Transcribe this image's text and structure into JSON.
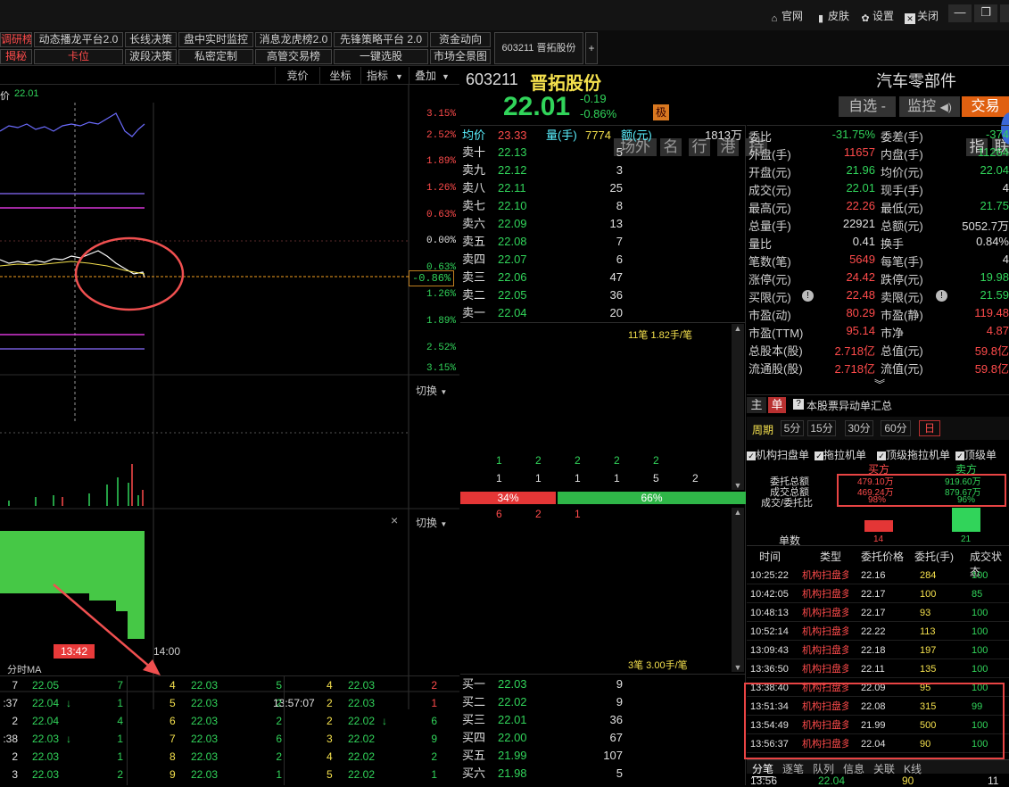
{
  "topbar": {
    "official": "官网",
    "skin": "皮肤",
    "settings": "设置",
    "close": "关闭"
  },
  "tabs_row1": [
    "调研榜",
    "动态播龙平台2.0",
    "长线决策",
    "盘中实时监控",
    "消息龙虎榜2.0",
    "先锋策略平台 2.0",
    "资金动向"
  ],
  "tabs_row2": [
    "揭秘",
    "卡位",
    "波段决策",
    "私密定制",
    "高管交易榜",
    "一键选股",
    "市场全景图"
  ],
  "active_tab": "603211 晋拓股份",
  "add_tab": "+",
  "chart_toolbar": {
    "price": "竞价",
    "coord": "坐标",
    "indicator": "指标",
    "overlay": "叠加"
  },
  "chart_price_label": "价",
  "chart_price": "22.01",
  "pct_labels_up": [
    "3.15%",
    "2.52%",
    "1.89%",
    "1.26%",
    "0.63%"
  ],
  "pct_zero": "0.00%",
  "pct_labels_down": [
    "0.63%",
    "1.26%",
    "1.89%",
    "2.52%",
    "3.15%"
  ],
  "pct_current": "-0.86%",
  "switch_label": "切换",
  "close_x": "×",
  "time_cursor": "13:42",
  "time_end": "14:00",
  "ma_label": "分时MA",
  "stock": {
    "code": "603211",
    "name": "晋拓股份",
    "tags": [
      "场外",
      "名",
      "行",
      "港",
      "持"
    ],
    "industry": "汽车零部件",
    "industry_btns": [
      "指",
      "联"
    ],
    "price": "22.01",
    "change": "-0.19",
    "change_pct": "-0.86%",
    "badge": "极"
  },
  "actions": {
    "fav": "自选",
    "monitor": "监控",
    "trade": "交易"
  },
  "summary": {
    "avg_label": "均价",
    "avg": "23.33",
    "vol_label": "量(手)",
    "vol": "7774",
    "amt_label": "额(元)",
    "amt": "1813万"
  },
  "sell": [
    {
      "label": "卖十",
      "price": "22.13",
      "qty": "5"
    },
    {
      "label": "卖九",
      "price": "22.12",
      "qty": "3"
    },
    {
      "label": "卖八",
      "price": "22.11",
      "qty": "25"
    },
    {
      "label": "卖七",
      "price": "22.10",
      "qty": "8"
    },
    {
      "label": "卖六",
      "price": "22.09",
      "qty": "13"
    },
    {
      "label": "卖五",
      "price": "22.08",
      "qty": "7"
    },
    {
      "label": "卖四",
      "price": "22.07",
      "qty": "6"
    },
    {
      "label": "卖三",
      "price": "22.06",
      "qty": "47"
    },
    {
      "label": "卖二",
      "price": "22.05",
      "qty": "36"
    },
    {
      "label": "卖一",
      "price": "22.04",
      "qty": "20"
    }
  ],
  "buy": [
    {
      "label": "买一",
      "price": "22.03",
      "qty": "9"
    },
    {
      "label": "买二",
      "price": "22.02",
      "qty": "9"
    },
    {
      "label": "买三",
      "price": "22.01",
      "qty": "36"
    },
    {
      "label": "买四",
      "price": "22.00",
      "qty": "67"
    },
    {
      "label": "买五",
      "price": "21.99",
      "qty": "107"
    },
    {
      "label": "买六",
      "price": "21.98",
      "qty": "5"
    }
  ],
  "queue_top": "11笔 1.82手/笔",
  "queue_bottom": "3笔 3.00手/笔",
  "queue_nums1": [
    "1",
    "2",
    "2",
    "2",
    "2"
  ],
  "queue_nums2": [
    "1",
    "1",
    "1",
    "1",
    "5",
    "2"
  ],
  "queue_nums3": [
    "6",
    "2",
    "1"
  ],
  "ratio_buy": "34%",
  "ratio_sell": "66%",
  "ratio_buy_value": 34,
  "stats_left": [
    {
      "k": "委比",
      "v": "-31.75%",
      "c": "g"
    },
    {
      "k": "外盘(手)",
      "v": "11657",
      "c": "r"
    },
    {
      "k": "开盘(元)",
      "v": "21.96",
      "c": "g"
    },
    {
      "k": "成交(元)",
      "v": "22.01",
      "c": "g"
    },
    {
      "k": "最高(元)",
      "v": "22.26",
      "c": "r"
    },
    {
      "k": "总量(手)",
      "v": "22921",
      "c": "w"
    },
    {
      "k": "量比",
      "v": "0.41",
      "c": "w"
    },
    {
      "k": "笔数(笔)",
      "v": "5649",
      "c": "r"
    },
    {
      "k": "涨停(元)",
      "v": "24.42",
      "c": "r"
    },
    {
      "k": "买限(元)",
      "v": "22.48",
      "c": "r"
    },
    {
      "k": "市盈(动)",
      "v": "80.29",
      "c": "r"
    },
    {
      "k": "市盈(TTM)",
      "v": "95.14",
      "c": "r"
    },
    {
      "k": "总股本(股)",
      "v": "2.718亿",
      "c": "r"
    },
    {
      "k": "流通股(股)",
      "v": "2.718亿",
      "c": "r"
    }
  ],
  "stats_right": [
    {
      "k": "委差(手)",
      "v": "-374",
      "c": "g"
    },
    {
      "k": "内盘(手)",
      "v": "11264",
      "c": "g"
    },
    {
      "k": "均价(元)",
      "v": "22.04",
      "c": "g"
    },
    {
      "k": "现手(手)",
      "v": "4",
      "c": "w"
    },
    {
      "k": "最低(元)",
      "v": "21.75",
      "c": "g"
    },
    {
      "k": "总额(元)",
      "v": "5052.7万",
      "c": "w"
    },
    {
      "k": "换手",
      "v": "0.84%",
      "c": "w"
    },
    {
      "k": "每笔(手)",
      "v": "4",
      "c": "w"
    },
    {
      "k": "跌停(元)",
      "v": "19.98",
      "c": "g"
    },
    {
      "k": "卖限(元)",
      "v": "21.59",
      "c": "g"
    },
    {
      "k": "市盈(静)",
      "v": "119.48",
      "c": "r"
    },
    {
      "k": "市净",
      "v": "4.87",
      "c": "r"
    },
    {
      "k": "总值(元)",
      "v": "59.8亿",
      "c": "r"
    },
    {
      "k": "流值(元)",
      "v": "59.8亿",
      "c": "r"
    }
  ],
  "unusual": {
    "main": "主",
    "single": "单",
    "title": "本股票异动单汇总",
    "period_label": "周期",
    "periods": [
      "5分",
      "15分",
      "30分",
      "60分",
      "日"
    ],
    "checks": [
      "机构扫盘单",
      "拖拉机单",
      "顶级拖拉机单",
      "顶级单"
    ]
  },
  "orders_summary": {
    "buy_label": "买方",
    "sell_label": "卖方",
    "row_labels": [
      "委托总额",
      "成交总额",
      "成交/委托比"
    ],
    "buy_vals": [
      "479.10万",
      "469.24万",
      "98%"
    ],
    "sell_vals": [
      "919.60万",
      "879.67万",
      "96%"
    ],
    "count_label": "单数",
    "buy_count": "14",
    "sell_count": "21"
  },
  "order_table": {
    "headers": [
      "时间",
      "类型",
      "委托价格",
      "委托(手)",
      "成交状态"
    ],
    "rows": [
      [
        "10:25:22",
        "机构扫盘多",
        "22.16",
        "284",
        "100"
      ],
      [
        "10:42:05",
        "机构扫盘多",
        "22.17",
        "100",
        "85"
      ],
      [
        "10:48:13",
        "机构扫盘多",
        "22.17",
        "93",
        "100"
      ],
      [
        "10:52:14",
        "机构扫盘多",
        "22.22",
        "113",
        "100"
      ],
      [
        "13:09:43",
        "机构扫盘多",
        "22.18",
        "197",
        "100"
      ],
      [
        "13:36:50",
        "机构扫盘多",
        "22.11",
        "135",
        "100"
      ],
      [
        "13:38:40",
        "机构扫盘多",
        "22.09",
        "95",
        "100"
      ],
      [
        "13:51:34",
        "机构扫盘多",
        "22.08",
        "315",
        "99"
      ],
      [
        "13:54:49",
        "机构扫盘多",
        "21.99",
        "500",
        "100"
      ],
      [
        "13:56:37",
        "机构扫盘多",
        "22.04",
        "90",
        "100"
      ]
    ]
  },
  "bottom_tabs": [
    "分笔",
    "逐笔",
    "队列",
    "信息",
    "关联",
    "K线"
  ],
  "bottom_tick": {
    "time": "13:56",
    "price": "22.04",
    "vol": "90",
    "n": "11"
  },
  "ticks": {
    "col1": [
      {
        "a": "7",
        "p": "22.05",
        "n": "7"
      },
      {
        "a": ":37",
        "p": "22.04",
        "arr": "↓",
        "n": "1"
      },
      {
        "a": "2",
        "p": "22.04",
        "n": "4"
      },
      {
        "a": ":38",
        "p": "22.03",
        "arr": "↓",
        "n": "1"
      },
      {
        "a": "2",
        "p": "22.03",
        "n": "1"
      },
      {
        "a": "3",
        "p": "22.03",
        "n": "2"
      }
    ],
    "col2": [
      {
        "a": "4",
        "p": "22.03",
        "n": "5"
      },
      {
        "a": "5",
        "p": "22.03",
        "n": "2"
      },
      {
        "a": "6",
        "p": "22.03",
        "n": "2"
      },
      {
        "a": "7",
        "p": "22.03",
        "n": "6"
      },
      {
        "a": "8",
        "p": "22.03",
        "n": "2"
      },
      {
        "a": "9",
        "p": "22.03",
        "n": "1"
      }
    ],
    "col3": [
      {
        "t": "",
        "a": "4",
        "p": "22.03",
        "n": "2"
      },
      {
        "t": "13:57:07",
        "a": "2",
        "p": "22.03",
        "n": "1"
      },
      {
        "t": "",
        "a": "2",
        "p": "22.02",
        "arr": "↓",
        "n": "6"
      },
      {
        "t": "",
        "a": "3",
        "p": "22.02",
        "n": "9"
      },
      {
        "t": "",
        "a": "4",
        "p": "22.02",
        "n": "2"
      },
      {
        "t": "",
        "a": "5",
        "p": "22.02",
        "n": "1"
      }
    ]
  }
}
